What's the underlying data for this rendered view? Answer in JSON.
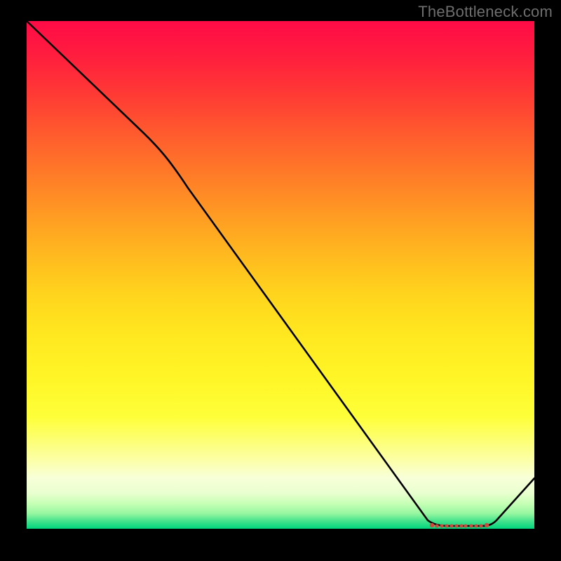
{
  "watermark": "TheBottleneck.com",
  "colors": {
    "background": "#000000",
    "watermark_text": "#6e6e6e",
    "curve": "#000000",
    "marker": "#d14a3e"
  },
  "chart_data": {
    "type": "line",
    "title": "",
    "xlabel": "",
    "ylabel": "",
    "xlim": [
      0,
      100
    ],
    "ylim": [
      0,
      100
    ],
    "series": [
      {
        "name": "bottleneck-curve",
        "x": [
          0,
          22,
          78,
          80,
          86,
          90,
          100
        ],
        "values": [
          100,
          78,
          1,
          0.5,
          0.5,
          1,
          10
        ]
      }
    ],
    "markers": {
      "name": "optimal-range",
      "x_range": [
        80,
        90
      ],
      "y": 0.8
    },
    "gradient_stops": [
      {
        "pos": 0,
        "color": "#ff0b47"
      },
      {
        "pos": 0.5,
        "color": "#ffd51d"
      },
      {
        "pos": 0.78,
        "color": "#feff39"
      },
      {
        "pos": 0.92,
        "color": "#f8ffd9"
      },
      {
        "pos": 1.0,
        "color": "#00d57e"
      }
    ]
  }
}
